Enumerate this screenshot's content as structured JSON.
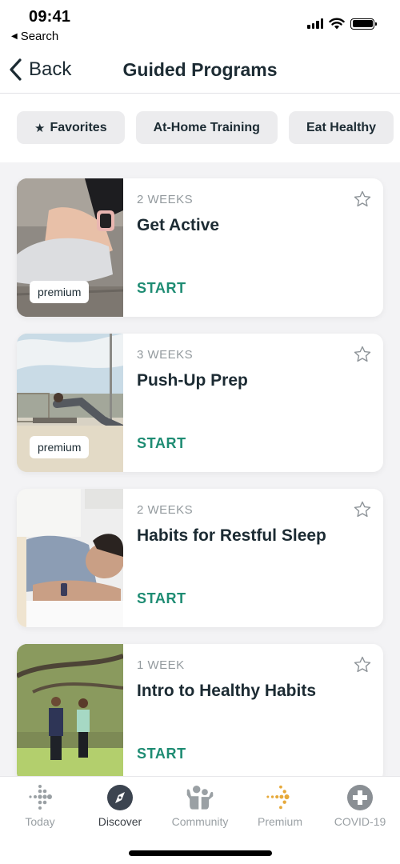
{
  "status_bar": {
    "time": "09:41",
    "back_app": "Search",
    "back_glyph": "◀"
  },
  "nav": {
    "back_label": "Back",
    "title": "Guided Programs"
  },
  "filters": [
    {
      "label": "Favorites",
      "icon": "star-filled-icon",
      "glyph": "★"
    },
    {
      "label": "At-Home Training"
    },
    {
      "label": "Eat Healthy"
    }
  ],
  "programs": [
    {
      "duration": "2 WEEKS",
      "title": "Get Active",
      "badge": "premium",
      "action": "START",
      "image": "tying-shoe-photo"
    },
    {
      "duration": "3 WEEKS",
      "title": "Push-Up Prep",
      "badge": "premium",
      "action": "START",
      "image": "push-up-outdoor-photo"
    },
    {
      "duration": "2 WEEKS",
      "title": "Habits for Restful Sleep",
      "badge": null,
      "action": "START",
      "image": "sleeping-woman-photo"
    },
    {
      "duration": "1 WEEK",
      "title": "Intro to Healthy Habits",
      "badge": null,
      "action": "START",
      "image": "couple-walking-park-photo"
    }
  ],
  "tabs": [
    {
      "label": "Today",
      "icon": "fitbit-dots-icon",
      "active": false
    },
    {
      "label": "Discover",
      "icon": "compass-icon",
      "active": true
    },
    {
      "label": "Community",
      "icon": "community-people-icon",
      "active": false
    },
    {
      "label": "Premium",
      "icon": "premium-dots-icon",
      "active": false
    },
    {
      "label": "COVID-19",
      "icon": "plus-circle-icon",
      "active": false
    }
  ],
  "colors": {
    "accent_green": "#1e8c73",
    "text_dark": "#1c2b33",
    "muted": "#939a9e",
    "premium_gold": "#e6a93a",
    "list_bg": "#f3f3f5"
  }
}
